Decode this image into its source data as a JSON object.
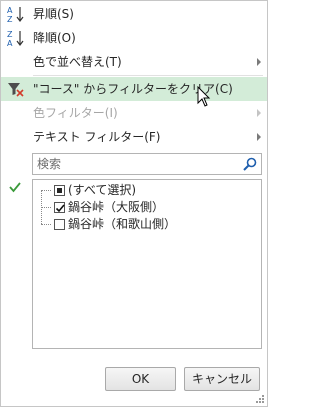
{
  "menu": {
    "sort_asc": "昇順(S)",
    "sort_desc": "降順(O)",
    "sort_by_color": "色で並べ替え(T)",
    "clear_filter": "\"コース\" からフィルターをクリア(C)",
    "color_filter": "色フィルター(I)",
    "text_filter": "テキスト フィルター(F)"
  },
  "search": {
    "placeholder": "検索"
  },
  "list": {
    "items": [
      {
        "label": "(すべて選択)",
        "state": "partial"
      },
      {
        "label": "鍋谷峠（大阪側）",
        "state": "checked"
      },
      {
        "label": "鍋谷峠（和歌山側）",
        "state": "unchecked"
      }
    ]
  },
  "buttons": {
    "ok": "OK",
    "cancel": "キャンセル"
  },
  "colors": {
    "hover_bg": "#d3ecd8",
    "sort_icon_blue": "#1f5fae",
    "filter_clear_red": "#d23b2b",
    "check_green": "#3a9a3a"
  },
  "icons": [
    "sort-ascending-icon",
    "sort-descending-icon",
    "clear-filter-icon",
    "search-icon",
    "checkmark-icon",
    "resize-grip-icon",
    "mouse-cursor-icon"
  ]
}
